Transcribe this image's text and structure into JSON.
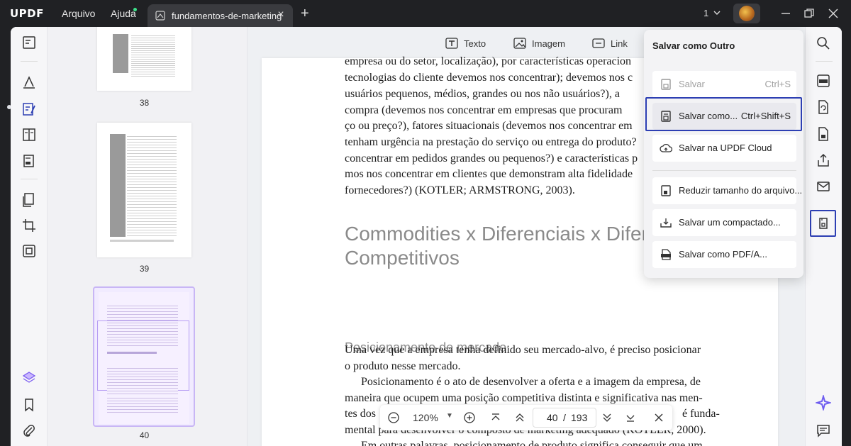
{
  "app": {
    "logo_main": "UPDF",
    "menu": {
      "file": "Arquivo",
      "help": "Ajuda"
    },
    "tab_title": "fundamentos-de-marketing",
    "tab_add": "+",
    "tab_close": "×",
    "page_selector": "1"
  },
  "edit_toolbar": {
    "text": "Texto",
    "image": "Imagem",
    "link": "Link"
  },
  "thumbnails": [
    {
      "label": "38"
    },
    {
      "label": "39"
    },
    {
      "label": "40"
    }
  ],
  "document": {
    "lines_top": [
      "empresa ou do setor, localização), por características operacion",
      "tecnologias do cliente devemos nos concentrar); devemos nos c",
      "usuários pequenos, médios, grandes ou nos não usuários?), a",
      "compra (devemos nos concentrar em empresas que procuram",
      "ço ou preço?), fatores situacionais (devemos nos concentrar em",
      "tenham urgência na prestação do serviço ou entrega do produto?",
      "concentrar em pedidos grandes ou pequenos?) e características p",
      "mos nos concentrar em clientes que demonstram alta fidelidade",
      "fornecedores?) (KOTLER; ARMSTRONG, 2003)."
    ],
    "heading_line1": "Commodities x Diferenciais x Diferenc",
    "heading_line2": "Competitivos",
    "subheading": "Posicionamento de mercado",
    "lines_bottom": [
      "Uma vez que a empresa tenha definido seu mercado-alvo, é preciso posicionar",
      "o produto nesse mercado.",
      "Posicionamento é o ato de desenvolver a oferta e a imagem da empresa, de",
      "maneira que ocupem uma posição competitiva distinta e significativa nas men-",
      "tes dos",
      "é funda-",
      "mental para desenvolver o composto de marketing adequado (KOTLER, 2000).",
      "Em outras palavras, posicionamento de produto significa conseguir que um"
    ]
  },
  "save_menu": {
    "title": "Salvar como Outro",
    "items": [
      {
        "label": "Salvar",
        "shortcut": "Ctrl+S"
      },
      {
        "label": "Salvar como...",
        "shortcut": "Ctrl+Shift+S"
      },
      {
        "label": "Salvar na UPDF Cloud",
        "shortcut": ""
      },
      {
        "label": "Reduzir tamanho do arquivo...",
        "shortcut": ""
      },
      {
        "label": "Salvar um compactado...",
        "shortcut": ""
      },
      {
        "label": "Salvar como PDF/A...",
        "shortcut": ""
      }
    ]
  },
  "navbar": {
    "zoom": "120%",
    "current_page": "40",
    "separator": "/",
    "total_pages": "193"
  },
  "colors": {
    "accent_selection": "#2d3fb3",
    "logo_accent": "#ffc107",
    "titlebar": "#202124"
  }
}
